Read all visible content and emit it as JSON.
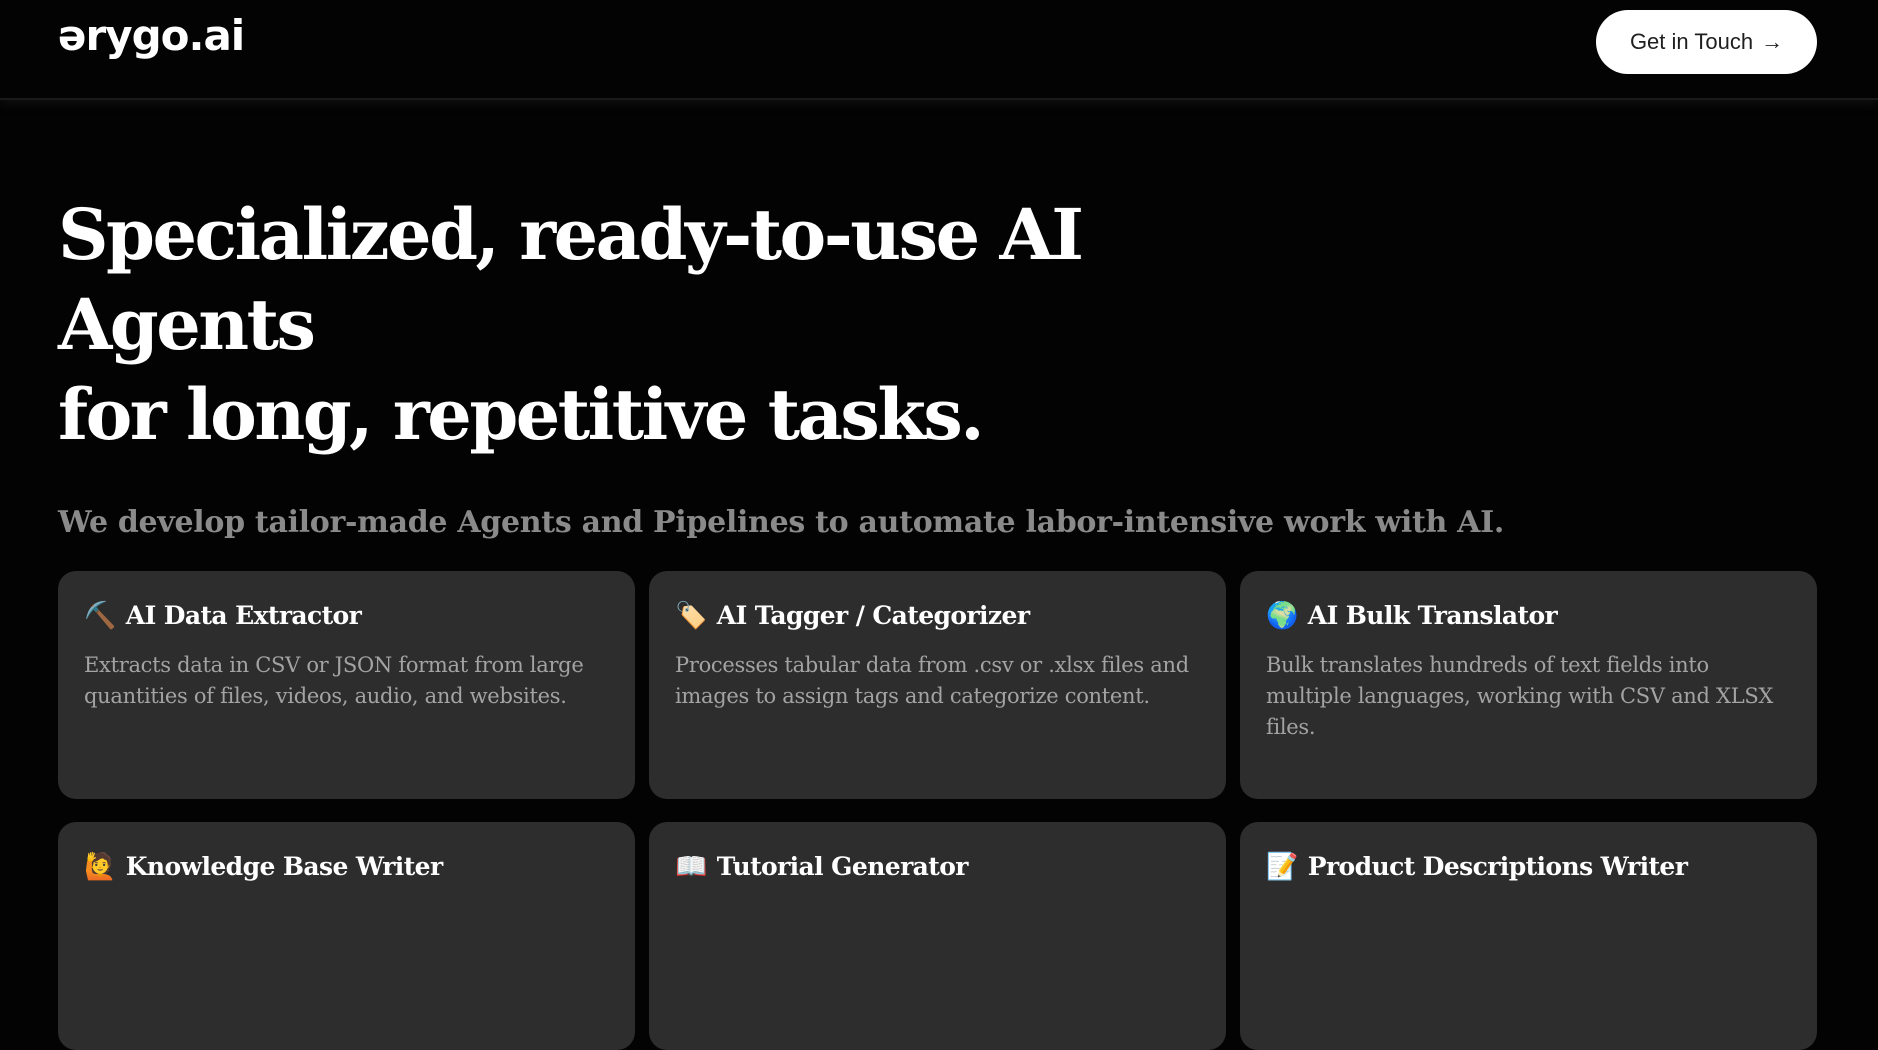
{
  "header": {
    "logo": "ərygo.ai",
    "cta_label": "Get in Touch",
    "cta_arrow": "→"
  },
  "hero": {
    "line1": "Specialized, ready-to-use AI Agents",
    "line2": "for long, repetitive tasks."
  },
  "tagline": "We develop tailor-made Agents and Pipelines to automate labor-intensive work with AI.",
  "cards": [
    {
      "icon": "⛏️",
      "icon_name": "pickaxe-icon",
      "title": "AI Data Extractor",
      "description": "Extracts data in CSV or JSON format from large quantities of files, videos, audio, and websites."
    },
    {
      "icon": "🏷️",
      "icon_name": "tag-icon",
      "title": "AI Tagger / Categorizer",
      "description": "Processes tabular data from .csv or .xlsx files and images to assign tags and categorize content."
    },
    {
      "icon": "🌍",
      "icon_name": "globe-icon",
      "title": "AI Bulk Translator",
      "description": "Bulk translates hundreds of text fields into multiple languages, working with CSV and XLSX files."
    },
    {
      "icon": "🙋",
      "icon_name": "person-raising-hand-icon",
      "title": "Knowledge Base Writer",
      "description": ""
    },
    {
      "icon": "📖",
      "icon_name": "open-book-icon",
      "title": "Tutorial Generator",
      "description": ""
    },
    {
      "icon": "📝",
      "icon_name": "memo-icon",
      "title": "Product Descriptions Writer",
      "description": ""
    }
  ],
  "colors": {
    "background": "#030303",
    "card": "#2d2d2d",
    "muted_text": "#8a8a8a",
    "cta_bg": "#ffffff"
  }
}
